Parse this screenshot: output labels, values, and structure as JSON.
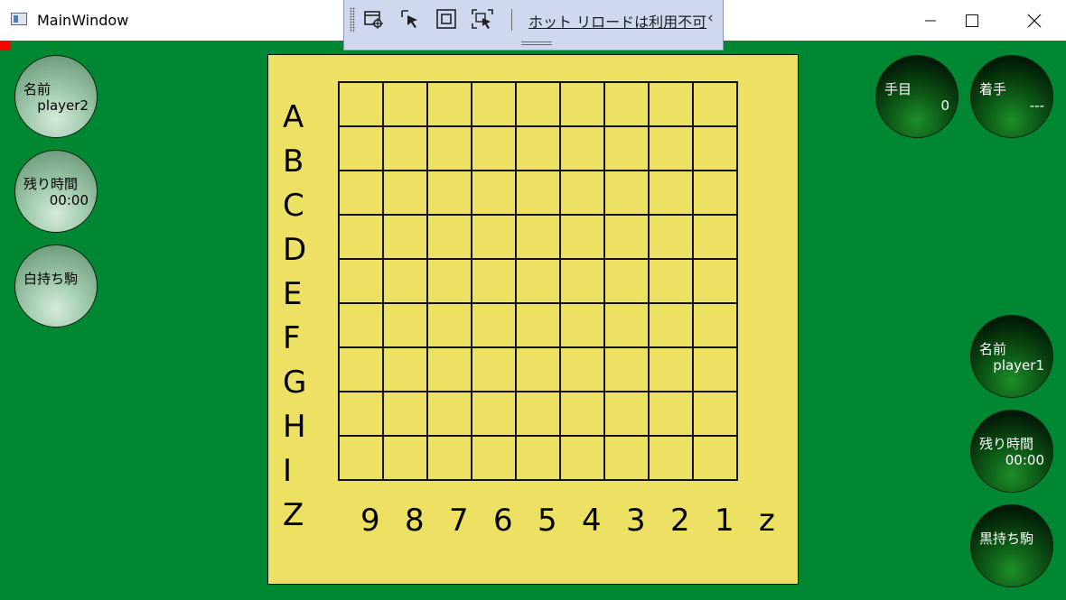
{
  "window": {
    "title": "MainWindow",
    "icon": "app-window-icon"
  },
  "toolbar": {
    "hot_reload_label": "ホット リロードは利用不可",
    "collapse_glyph": "‹",
    "icons": [
      "select-element-icon",
      "pointer-icon",
      "frame-icon",
      "track-focus-icon"
    ]
  },
  "left_panel": {
    "name": {
      "label": "名前",
      "value": "player2"
    },
    "time": {
      "label": "残り時間",
      "value": "00:00"
    },
    "captured": {
      "label": "白持ち駒"
    }
  },
  "right_panel": {
    "move_count": {
      "label": "手目",
      "value": "0"
    },
    "last_move": {
      "label": "着手",
      "value": "---"
    },
    "name": {
      "label": "名前",
      "value": "player1"
    },
    "time": {
      "label": "残り時間",
      "value": "00:00"
    },
    "captured": {
      "label": "黒持ち駒"
    }
  },
  "board": {
    "rows": 9,
    "cols": 9,
    "rank_labels": [
      "A",
      "B",
      "C",
      "D",
      "E",
      "F",
      "G",
      "H",
      "I",
      "Z"
    ],
    "file_labels": [
      "9",
      "8",
      "7",
      "6",
      "5",
      "4",
      "3",
      "2",
      "1",
      "z"
    ]
  },
  "colors": {
    "background": "#008732",
    "board": "#ede164",
    "toolbar": "#cfd8ef",
    "accent_red": "#ff0000"
  }
}
